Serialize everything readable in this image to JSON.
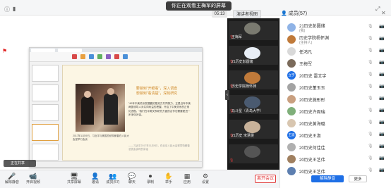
{
  "share_banner": "你正在观看王梅军的屏幕",
  "timer": "05:13",
  "view_button": "演讲者视图",
  "members": {
    "title": "成员(57)",
    "unmute_all": "解除静音",
    "more": "更多",
    "list": [
      {
        "name": "21历史彭圆储",
        "sub": "(我)",
        "color": "#8fb3e6",
        "avatar": ""
      },
      {
        "name": "历史学院杨怀渊",
        "sub": "(主持人)",
        "color": "#c07a3a",
        "avatar": ""
      },
      {
        "name": "任鸿凡",
        "sub": "",
        "color": "#d9d9d9",
        "avatar": ""
      },
      {
        "name": "王梅军",
        "sub": "",
        "color": "#7a6a5a",
        "avatar": ""
      },
      {
        "name": "20历史 雷立宇",
        "sub": "",
        "color": "#1e6fe6",
        "avatar": "立宇"
      },
      {
        "name": "20历史董玉玉",
        "sub": "",
        "color": "#a3a3a3",
        "avatar": ""
      },
      {
        "name": "20历史施彤彤",
        "sub": "",
        "color": "#c9a080",
        "avatar": ""
      },
      {
        "name": "20历史许周瑞",
        "sub": "",
        "color": "#7faf7a",
        "avatar": ""
      },
      {
        "name": "20历史黄海璐",
        "sub": "",
        "color": "#d8c6b0",
        "avatar": ""
      },
      {
        "name": "20历史王淑",
        "sub": "",
        "color": "#1e6fe6",
        "avatar": "王淑"
      },
      {
        "name": "20历史何佳佳",
        "sub": "",
        "color": "#b0b0b0",
        "avatar": ""
      },
      {
        "name": "20历史王艺伟",
        "sub": "",
        "color": "#a08060",
        "avatar": ""
      },
      {
        "name": "20历史王艺伟",
        "sub": "",
        "color": "#5d7fb0",
        "avatar": ""
      }
    ]
  },
  "gallery": [
    {
      "name": "王梅军",
      "color": "#7a7a70"
    },
    {
      "name": "21历史彭圆储",
      "color": "#e8eef6"
    },
    {
      "name": "历史学院杨怀渊",
      "color": "#c07a3a"
    },
    {
      "name": "马斗星（青岛大学）",
      "color": "#4a5a70"
    },
    {
      "name": "21历史 宋慧雯",
      "color": "#c8b29a"
    },
    {
      "name": "",
      "color": "#555555"
    }
  ],
  "slide": {
    "quote": "要做到\"开眼看\"，深入调查\n想做到\"看清楚\"，深刻研究",
    "body": "\"40年中美关系发展靠的是双方共同努力，正是当年中美两国领导人对共同利益的把握，开启了中美关系的正常化进程。\"我们在中美关系研究方面的合作也需要更进一步深化对话。",
    "signature": "——习近平2017年11月9日，在北京人民大会堂同特朗普总统会谈时的讲话",
    "caption": "2017年11月9日，习近平与美国总统特朗普在人民大会堂举行会谈"
  },
  "mini_window": "正在共享",
  "toolbar": [
    {
      "icon": "mic-muted-icon",
      "glyph": "🎤",
      "label": "解除静音"
    },
    {
      "icon": "video-off-icon",
      "glyph": "📹",
      "label": "开启视频"
    },
    {
      "icon": "share-screen-icon",
      "glyph": "🖥",
      "label": "共享屏幕"
    },
    {
      "icon": "invite-icon",
      "glyph": "👤",
      "label": "邀请"
    },
    {
      "icon": "members-icon",
      "glyph": "👥",
      "label": "成员(57)"
    },
    {
      "icon": "chat-icon",
      "glyph": "💬",
      "label": "聊天"
    },
    {
      "icon": "record-icon",
      "glyph": "⏺",
      "label": "录制"
    },
    {
      "icon": "raise-hand-icon",
      "glyph": "✋",
      "label": "举手"
    },
    {
      "icon": "apps-icon",
      "glyph": "▦",
      "label": "应用"
    },
    {
      "icon": "settings-icon",
      "glyph": "⚙",
      "label": "设置"
    }
  ],
  "leave_button": "离开会议"
}
